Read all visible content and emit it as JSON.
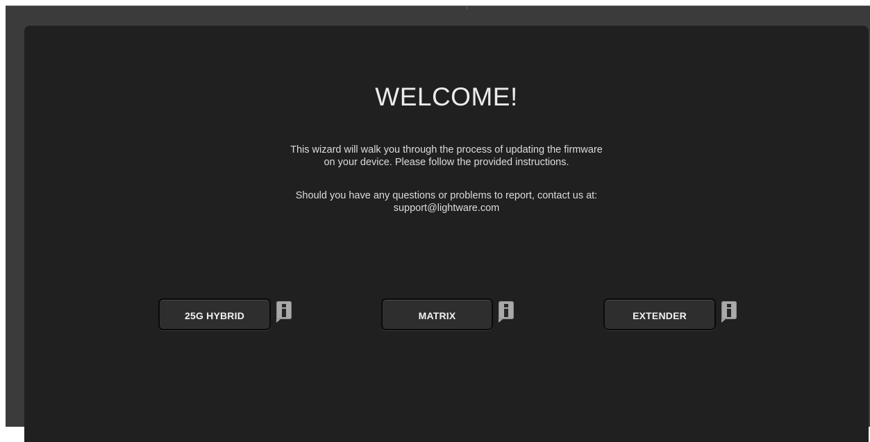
{
  "welcome": {
    "title": "WELCOME!",
    "intro_line1": "This wizard will walk you through the process of updating the firmware",
    "intro_line2": "on your device. Please follow the provided instructions.",
    "contact_line1": "Should you have any questions or problems to report, contact us at:",
    "contact_email": "support@lightware.com"
  },
  "options": [
    {
      "label": "25G HYBRID",
      "info_icon": "info-icon"
    },
    {
      "label": "MATRIX",
      "info_icon": "info-icon"
    },
    {
      "label": "EXTENDER",
      "info_icon": "info-icon"
    }
  ],
  "colors": {
    "background": "#202020",
    "frame": "#3b3b3b",
    "button": "#2e2e2e",
    "text": "#ececec",
    "info_badge": "#a9a9a9"
  }
}
